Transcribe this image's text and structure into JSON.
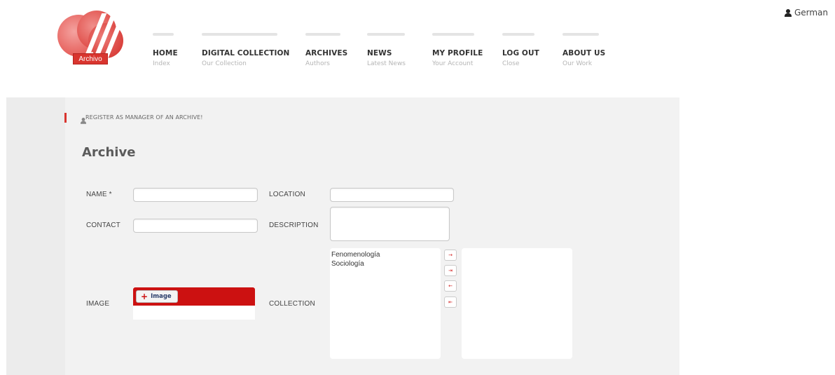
{
  "language": {
    "label": "German"
  },
  "logo": {
    "label": "Archivo"
  },
  "nav": [
    {
      "label": "HOME",
      "sub": "Index"
    },
    {
      "label": "DIGITAL COLLECTION",
      "sub": "Our Collection"
    },
    {
      "label": "ARCHIVES",
      "sub": "Authors"
    },
    {
      "label": "NEWS",
      "sub": "Latest News"
    },
    {
      "label": "MY PROFILE",
      "sub": "Your Account"
    },
    {
      "label": "LOG OUT",
      "sub": "Close"
    },
    {
      "label": "ABOUT US",
      "sub": "Our Work"
    }
  ],
  "breadcrumb": {
    "text": "REGISTER AS MANAGER OF AN ARCHIVE!"
  },
  "page_title": "Archive",
  "form": {
    "name_label": "NAME *",
    "name_value": "",
    "location_label": "LOCATION",
    "location_value": "",
    "contact_label": "CONTACT",
    "contact_value": "",
    "description_label": "DESCRIPTION",
    "description_value": "",
    "image_label": "IMAGE",
    "image_button": "Image",
    "collection_label": "COLLECTION",
    "available_options": [
      "Fenomenología",
      "Sociología"
    ],
    "selected_options": [],
    "transfer_buttons": [
      {
        "name": "move-right-button",
        "glyph": "→"
      },
      {
        "name": "move-all-right-button",
        "glyph": "⇥"
      },
      {
        "name": "move-left-button",
        "glyph": "←"
      },
      {
        "name": "move-all-left-button",
        "glyph": "⇤"
      }
    ]
  },
  "colors": {
    "accent": "#d9352f",
    "image_bar": "#cc1111",
    "panel": "#f2f2f2"
  }
}
